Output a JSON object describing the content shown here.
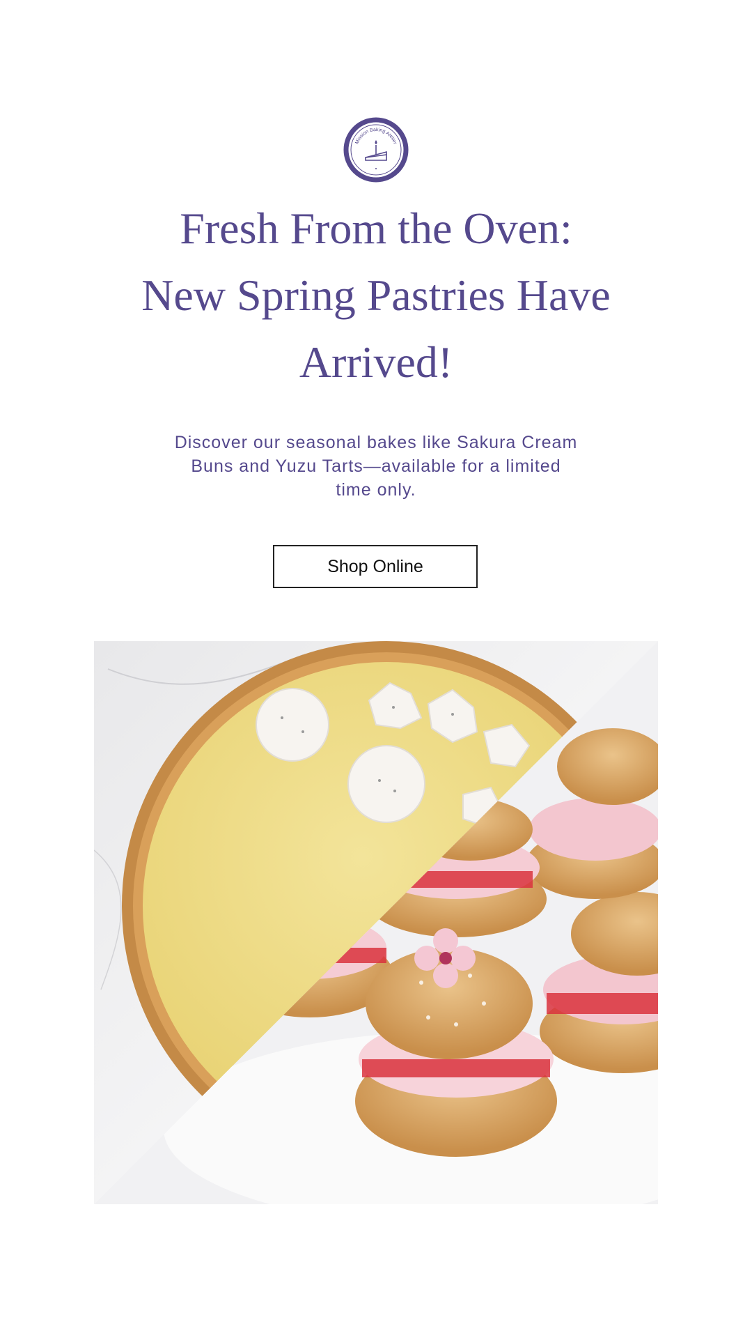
{
  "logo": {
    "arc_text": "Mission Baking Atelier",
    "icon": "cake-slice-candle-icon",
    "color": "#55498d"
  },
  "headline": {
    "line1": "Fresh From the Oven:",
    "line2": "New Spring Pastries Have",
    "line3": "Arrived!"
  },
  "body": {
    "text": "Discover our seasonal bakes like Sakura Cream Buns and Yuzu Tarts—available for a limited time only."
  },
  "cta": {
    "label": "Shop Online"
  },
  "hero_image": {
    "description_icon": "pastry-photo",
    "left_subject": "yuzu-tart",
    "right_subject": "sakura-cream-buns"
  },
  "colors": {
    "brand": "#55498d",
    "text_dark": "#111111",
    "background": "#ffffff"
  }
}
